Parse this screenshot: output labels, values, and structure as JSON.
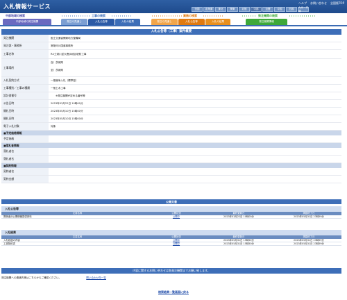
{
  "header": {
    "title": "入札情報サービス",
    "links": [
      "ヘルプ",
      "お問い合わせ",
      "全国版TOP"
    ],
    "regions_row1": [
      "全国",
      "北海道",
      "東北",
      "関東",
      "北陸",
      "中部"
    ],
    "regions_row2": [
      "近畿",
      "中国",
      "四国",
      "九州・沖縄"
    ]
  },
  "menu": {
    "group1": {
      "title": "中部地域の検索",
      "tabs": [
        "中部地域の発注機関"
      ]
    },
    "group2": {
      "title": "工事の検索",
      "tabs": [
        "発注の見通し",
        "入札公告等",
        "入札の結果"
      ]
    },
    "group3": {
      "title": "業務の検索",
      "tabs": [
        "発注の見通し",
        "入札公告等",
        "入札の結果"
      ]
    },
    "group4": {
      "title": "発注機関の検索",
      "tabs": [
        "発注機関情報"
      ]
    }
  },
  "main": {
    "title": "入札公告等（工事）案件概要",
    "fields": [
      {
        "label": "発注機関",
        "value": "国土交通省関東地方整備局"
      },
      {
        "label": "発注部・事務所",
        "value": "常陸河川国道事務所"
      },
      {
        "label": "工事名称",
        "value": "R4土浦川並大鹿浜地区堤防工事"
      }
    ],
    "location": {
      "label": "工事場所",
      "lines": [
        "自）茨城県",
        "至）茨城県"
      ]
    },
    "fields2": [
      {
        "label": "入札契約方式",
        "value": "一般競争入札（標準型）"
      },
      {
        "label": "工事種別／工事の種類",
        "value": "一般土木工事"
      },
      {
        "label": "設計書番号",
        "value": "　　※発注機関が定める番号等"
      },
      {
        "label": "公告日時",
        "value": "2023年03月22日 10時00分"
      },
      {
        "label": "開札日時",
        "value": "2023年05月10日 15時00分"
      },
      {
        "label": "開札日時",
        "value": "2023年05月10日 15時00分"
      },
      {
        "label": "電子入札対象",
        "value": "対象"
      }
    ],
    "sections": [
      {
        "title": "■予定価格情報",
        "rows": [
          "予定価格"
        ]
      },
      {
        "title": "■落札者情報",
        "rows": [
          "落札者名",
          "落札者名"
        ]
      },
      {
        "title": "■契約情報",
        "rows": [
          "契約者名",
          "契約金額"
        ]
      }
    ]
  },
  "publish": {
    "title": "公開文書",
    "groups": [
      {
        "name": "入札公告等",
        "columns": [
          "文書名称",
          "公開状況",
          "最終更新日",
          "掲載終了日"
        ],
        "rows": [
          {
            "name": "関係者分公開情報提供資料",
            "status": "公開中",
            "updated": "2023年03月22日 10時00分",
            "ends": "2023年05月31日 23時59分"
          }
        ]
      },
      {
        "name": "入札結果",
        "columns": [
          "文書名称",
          "公開状況",
          "最終更新日",
          "掲載終了日"
        ],
        "rows": [
          {
            "name": "入札経過の内容",
            "status": "公開中",
            "updated": "2023年05月31日 15時50分",
            "ends": "2023年05月31日 23時59分"
          },
          {
            "name": "工事契約書",
            "status": "公開中",
            "updated": "2023年05月31日 15時50分",
            "ends": "2023年05月31日 23時59分"
          }
        ]
      }
    ]
  },
  "footer": {
    "notice": "内容に関するお問い合わせは各発注機関までお願い致します。",
    "contact_text": "発注機関への連絡先等はこちらからご確認ください。",
    "contact_link": "問い合わせ先一覧",
    "back_link": "検索結果一覧画面に戻る"
  },
  "colors": {
    "primary": "#3d6eb8",
    "header": "#2e5fa3",
    "group_blue": "#3d6eb8",
    "group_orange": "#e07a10",
    "group_green": "#3ea93a",
    "group_purple": "#4a4aa8"
  }
}
